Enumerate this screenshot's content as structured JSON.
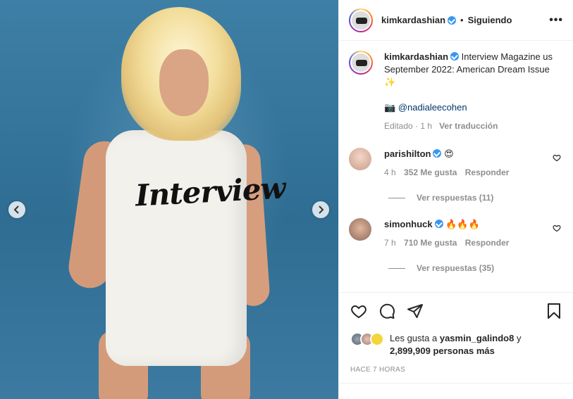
{
  "post": {
    "username": "kimkardashian",
    "follow_status": "Siguiendo",
    "more_label": "•••",
    "separator": "•",
    "shirt_text": "Interview"
  },
  "caption": {
    "username": "kimkardashian",
    "text": "Interview Magazine us September 2022: American Dream Issue ✨",
    "camera_icon": "camera-emoji",
    "camera_glyph": "📷",
    "mention": "@nadialeecohen",
    "edited_label": "Editado",
    "time": "1 h",
    "translate_label": "Ver traducción",
    "meta_separator": "·"
  },
  "comments": [
    {
      "username": "parishilton",
      "text": "😍",
      "time": "4 h",
      "likes": "352 Me gusta",
      "reply_label": "Responder",
      "view_replies": "Ver respuestas (11)"
    },
    {
      "username": "simonhuck",
      "text": "🔥🔥🔥",
      "time": "7 h",
      "likes": "710 Me gusta",
      "reply_label": "Responder",
      "view_replies": "Ver respuestas (35)"
    }
  ],
  "likes_line": {
    "prefix": "Les gusta a",
    "user": "yasmin_galindo8",
    "join": "y",
    "count": "2,899,909 personas más"
  },
  "timestamp": "HACE 7 HORAS",
  "icons": [
    "chevron-left-icon",
    "chevron-right-icon",
    "heart-icon",
    "comment-icon",
    "share-icon",
    "bookmark-icon",
    "verified-badge-icon"
  ],
  "colors": {
    "verified": "#3897f0",
    "muted_text": "#8e8e8e",
    "link": "#00376b",
    "photo_background": "#3e7fa6"
  }
}
